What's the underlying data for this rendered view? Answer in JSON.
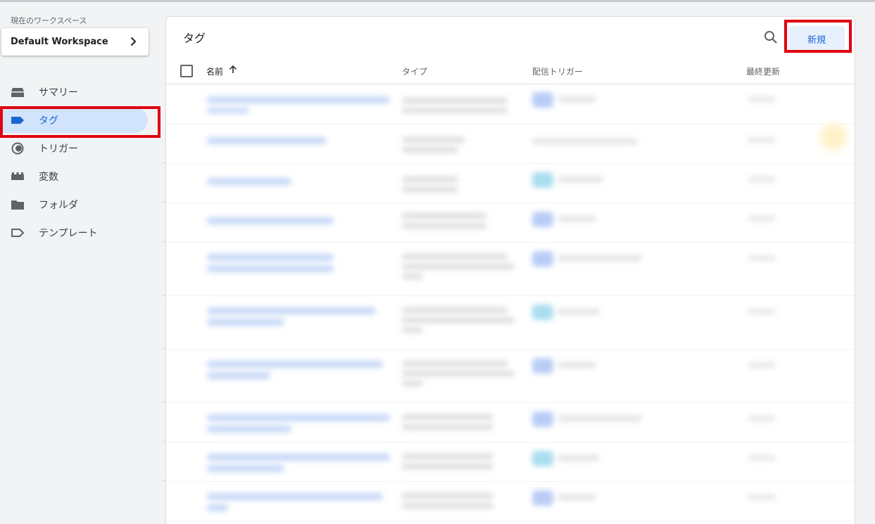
{
  "workspace": {
    "label": "現在のワークスペース",
    "name": "Default Workspace"
  },
  "nav": {
    "items": [
      {
        "label": "サマリー",
        "icon": "summary-icon"
      },
      {
        "label": "タグ",
        "icon": "tag-icon",
        "active": true
      },
      {
        "label": "トリガー",
        "icon": "trigger-icon"
      },
      {
        "label": "変数",
        "icon": "variables-icon"
      },
      {
        "label": "フォルダ",
        "icon": "folder-icon"
      },
      {
        "label": "テンプレート",
        "icon": "template-icon"
      }
    ]
  },
  "panel": {
    "title": "タグ",
    "new_button": "新規",
    "search_icon": "search-icon"
  },
  "table": {
    "columns": {
      "name": "名前",
      "type": "タイプ",
      "trigger": "配信トリガー",
      "updated": "最終更新"
    },
    "sort_icon": "arrow-up-icon"
  },
  "colors": {
    "accent": "#1967d2",
    "active_bg": "#d2e3fc",
    "highlight": "#e0000f"
  }
}
